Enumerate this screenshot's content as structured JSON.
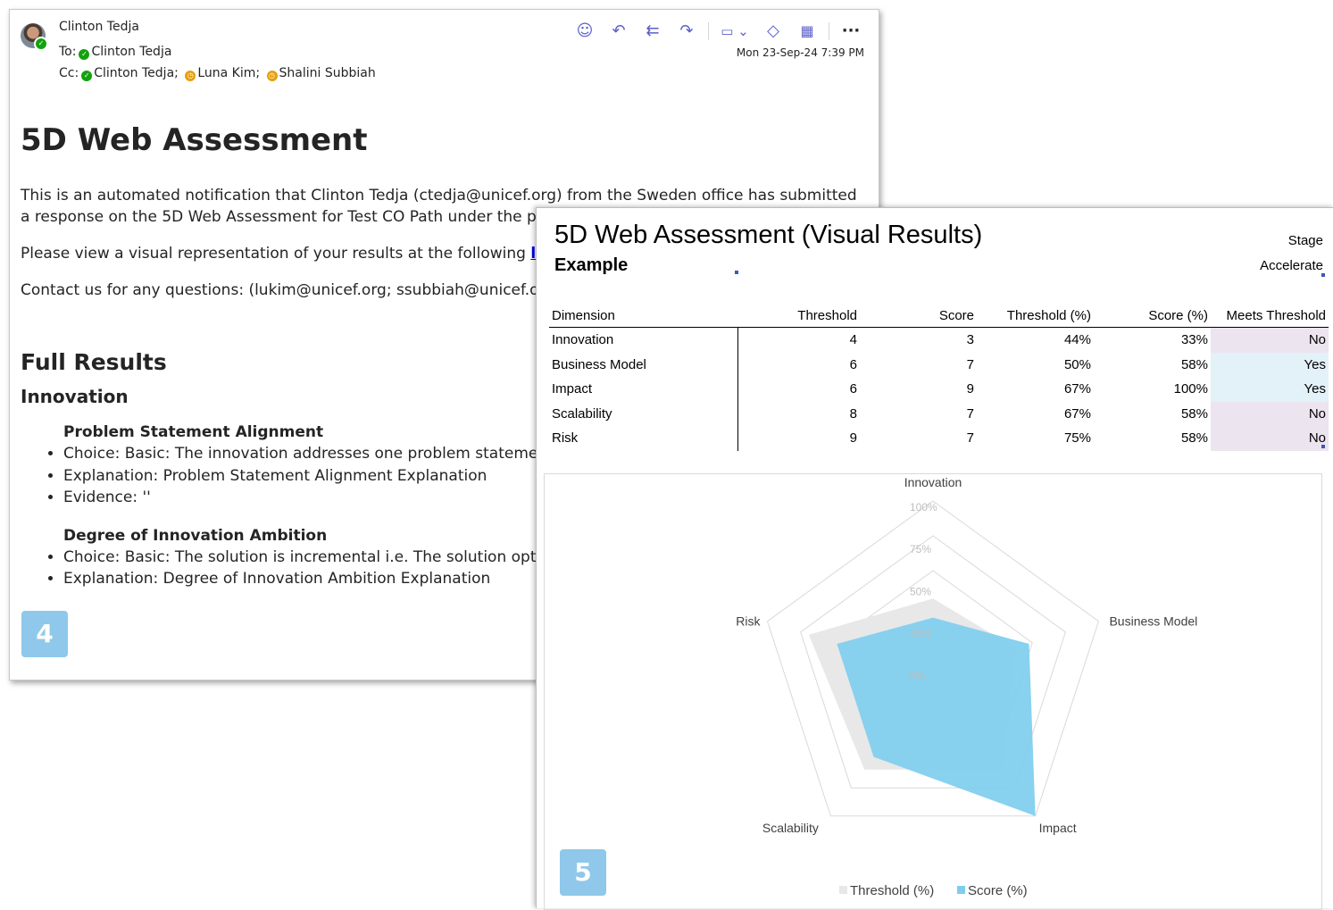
{
  "email": {
    "sender": "Clinton Tedja",
    "to_label": "To:",
    "to": "Clinton Tedja",
    "cc_label": "Cc:",
    "cc": [
      "Clinton Tedja;",
      "Luna Kim;",
      "Shalini Subbiah"
    ],
    "date": "Mon 23-Sep-24 7:39 PM",
    "toolbar": [
      "smile-icon",
      "reply-icon",
      "reply-all-icon",
      "forward-icon",
      "apps-icon",
      "loop-icon",
      "grid-icon",
      "more-icon"
    ],
    "title": "5D Web Assessment",
    "p1": "This is an automated notification that Clinton Tedja (ctedja@unicef.org) from the Sweden office has submitted a response on the 5D Web Assessment for Test CO Path under the portfolio path.",
    "p2_prefix": "Please view a visual representation of your results at the following",
    "p2_link": "link",
    "p2_suffix": ".",
    "p3": "Contact us for any questions: (lukim@unicef.org; ssubbiah@unicef.org;",
    "full_results": "Full Results",
    "section": "Innovation",
    "q1_title": "Problem Statement Alignment",
    "q1_items": [
      "Choice: Basic: The innovation addresses one problem statement c",
      "Explanation: Problem Statement Alignment Explanation",
      "Evidence: ''"
    ],
    "q2_title": "Degree of Innovation Ambition",
    "q2_items": [
      "Choice: Basic: The solution is incremental i.e. The solution optimiz efficient and effective.",
      "Explanation: Degree of Innovation Ambition Explanation"
    ],
    "badge": "4"
  },
  "results": {
    "title": "5D Web Assessment (Visual Results)",
    "subtitle": "Example",
    "stage_label": "Stage",
    "stage_value": "Accelerate",
    "headers": [
      "Dimension",
      "Threshold",
      "Score",
      "Threshold (%)",
      "Score (%)",
      "Meets Threshold"
    ],
    "rows": [
      [
        "Innovation",
        "4",
        "3",
        "44%",
        "33%",
        "No"
      ],
      [
        "Business Model",
        "6",
        "7",
        "50%",
        "58%",
        "Yes"
      ],
      [
        "Impact",
        "6",
        "9",
        "67%",
        "100%",
        "Yes"
      ],
      [
        "Scalability",
        "8",
        "7",
        "67%",
        "58%",
        "No"
      ],
      [
        "Risk",
        "9",
        "7",
        "75%",
        "58%",
        "No"
      ]
    ],
    "badge": "5"
  },
  "chart_data": {
    "type": "radar",
    "categories": [
      "Innovation",
      "Business Model",
      "Impact",
      "Scalability",
      "Risk"
    ],
    "series": [
      {
        "name": "Threshold (%)",
        "values": [
          44,
          50,
          67,
          67,
          75
        ],
        "color": "#e8e8e8"
      },
      {
        "name": "Score (%)",
        "values": [
          33,
          58,
          100,
          58,
          58
        ],
        "color": "#7ecdee"
      }
    ],
    "ticks": [
      "0%",
      "25%",
      "50%",
      "75%",
      "100%"
    ],
    "range": [
      0,
      100
    ],
    "legend": "bottom"
  }
}
